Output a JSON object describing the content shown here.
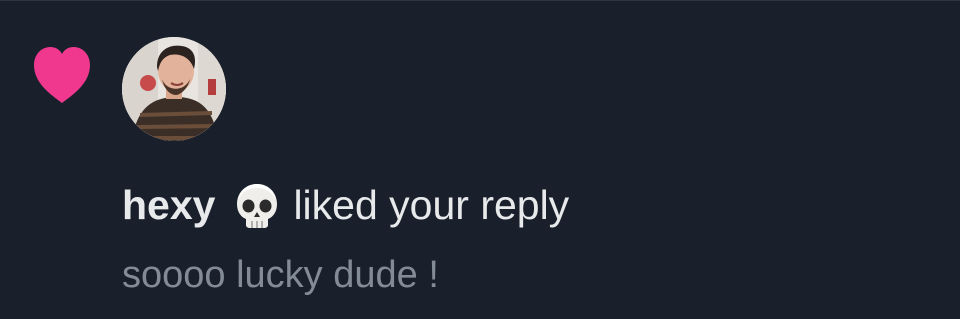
{
  "colors": {
    "background": "#19202c",
    "heart": "#f0388f",
    "primary_text": "#e7e9ea",
    "secondary_text": "#828b96"
  },
  "notification": {
    "type_icon": "heart-icon",
    "avatar_icon": "user-avatar",
    "username": "hexy",
    "username_emoji_icon": "skull-icon",
    "action_text": "liked your reply",
    "reply_text": "soooo lucky dude !"
  }
}
